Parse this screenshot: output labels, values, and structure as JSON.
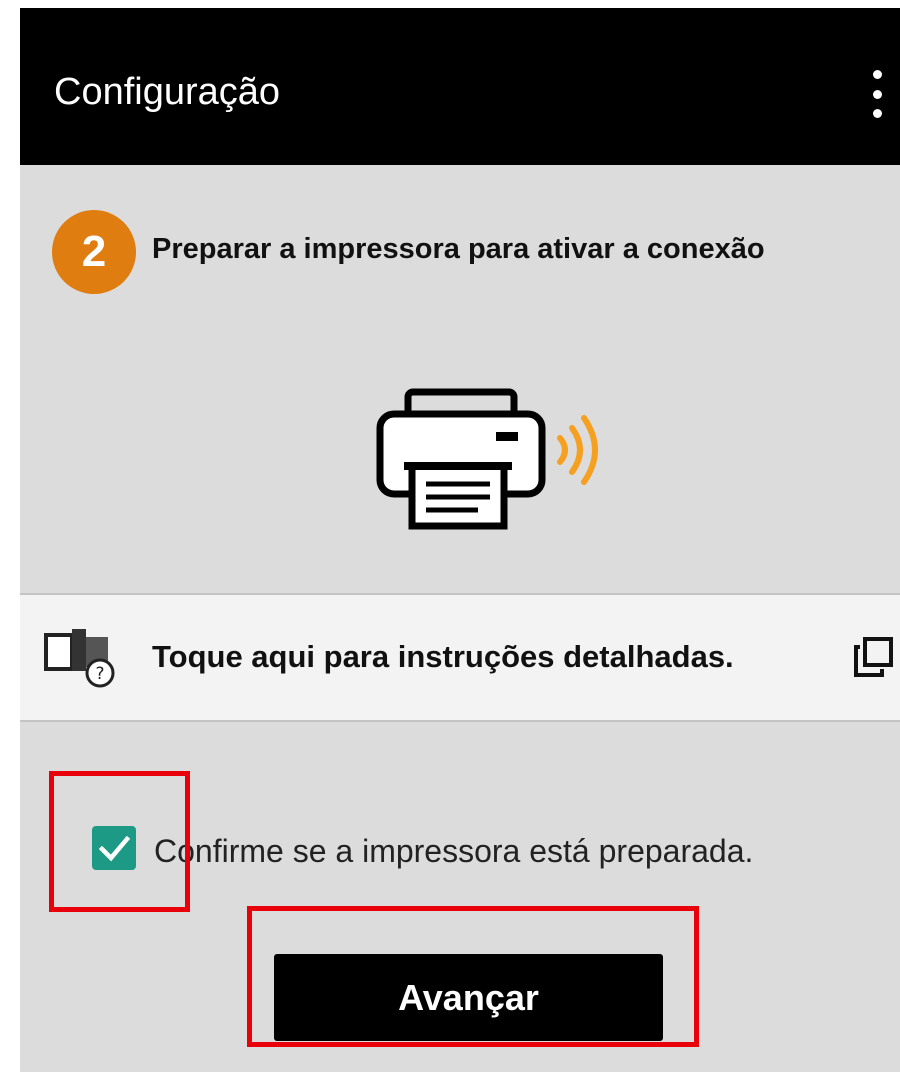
{
  "app_bar": {
    "title": "Configuração",
    "menu_icon": "more-vert-icon"
  },
  "step": {
    "number": "2",
    "text": "Preparar a impressora para ativar a conexão",
    "badge_color": "#e07d10"
  },
  "illustration": {
    "icon": "printer-wireless-icon",
    "signal_color": "#f5a020"
  },
  "instructions_bar": {
    "text": "Toque aqui para instruções detalhadas.",
    "left_icon": "manual-help-icon",
    "right_icon": "open-external-icon"
  },
  "confirm": {
    "checked": true,
    "label": "Confirme se a impressora está preparada.",
    "check_color": "#1d9a86"
  },
  "next_button": {
    "label": "Avançar"
  },
  "highlight_color": "#e8000b"
}
